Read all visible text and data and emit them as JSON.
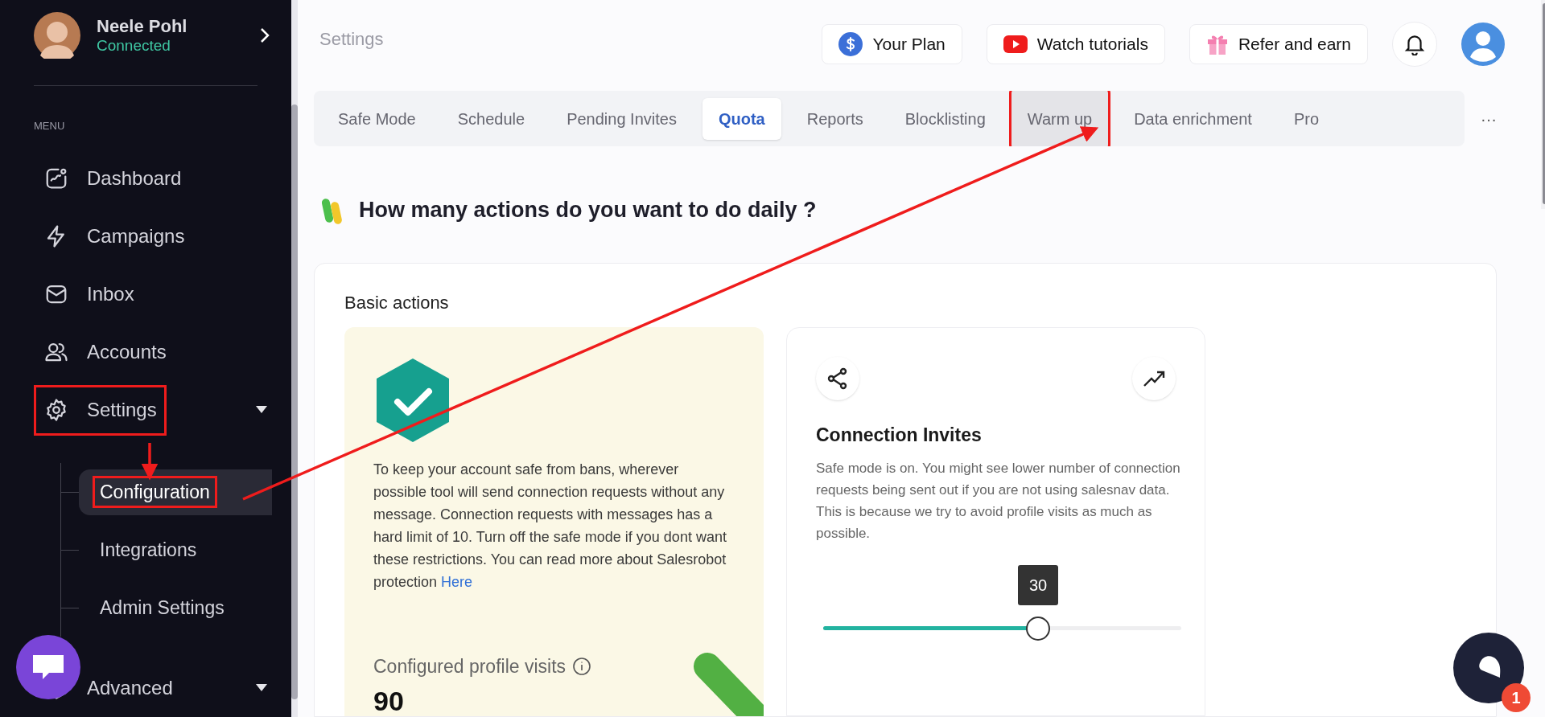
{
  "sidebar": {
    "user": {
      "name": "Neele Pohl",
      "status": "Connected"
    },
    "menu_label": "MENU",
    "items": [
      {
        "label": "Dashboard",
        "kind": "link",
        "selected": false,
        "annotated": false
      },
      {
        "label": "Campaigns",
        "kind": "link",
        "selected": false,
        "annotated": false
      },
      {
        "label": "Inbox",
        "kind": "link",
        "selected": false,
        "annotated": false
      },
      {
        "label": "Accounts",
        "kind": "link",
        "selected": false,
        "annotated": false
      },
      {
        "label": "Settings",
        "kind": "group",
        "selected": false,
        "annotated": true,
        "expanded": true,
        "children": [
          {
            "label": "Configuration",
            "selected": true,
            "annotated": true
          },
          {
            "label": "Integrations",
            "selected": false,
            "annotated": false
          },
          {
            "label": "Admin Settings",
            "selected": false,
            "annotated": false
          }
        ]
      },
      {
        "label": "Advanced",
        "kind": "group",
        "selected": false,
        "annotated": false
      }
    ]
  },
  "header": {
    "title": "Settings",
    "buttons": [
      {
        "label": "Your Plan",
        "kind": "plan"
      },
      {
        "label": "Watch tutorials",
        "kind": "video"
      },
      {
        "label": "Refer and earn",
        "kind": "gift"
      }
    ]
  },
  "tabs": [
    {
      "label": "Safe Mode",
      "selected": false,
      "annotated": false
    },
    {
      "label": "Schedule",
      "selected": false,
      "annotated": false
    },
    {
      "label": "Pending Invites",
      "selected": false,
      "annotated": false
    },
    {
      "label": "Quota",
      "selected": true,
      "annotated": false
    },
    {
      "label": "Reports",
      "selected": false,
      "annotated": false
    },
    {
      "label": "Blocklisting",
      "selected": false,
      "annotated": false
    },
    {
      "label": "Warm up",
      "selected": false,
      "annotated": true
    },
    {
      "label": "Data enrichment",
      "selected": false,
      "annotated": false
    },
    {
      "label": "Pro",
      "selected": false,
      "annotated": false
    }
  ],
  "tabs_more": "···",
  "heading": "How many actions do you want to do daily ?",
  "section": {
    "title": "Basic actions",
    "safe_card": {
      "text": "To keep your account safe from bans, wherever possible tool will send connection requests without any message. Connection requests with messages has a hard limit of 10. Turn off the safe mode if you dont want these restrictions. You can read more about Salesrobot protection",
      "link": "Here",
      "metric_label": "Configured profile visits",
      "metric_value": "90"
    },
    "invites_card": {
      "title": "Connection Invites",
      "text": "Safe mode is on. You might see lower number of connection requests being sent out if you are not using salesnav data. This is because we try to avoid profile visits as much as possible.",
      "slider": {
        "level": 0.6,
        "reading": "30"
      }
    }
  },
  "chat_badge": "1"
}
